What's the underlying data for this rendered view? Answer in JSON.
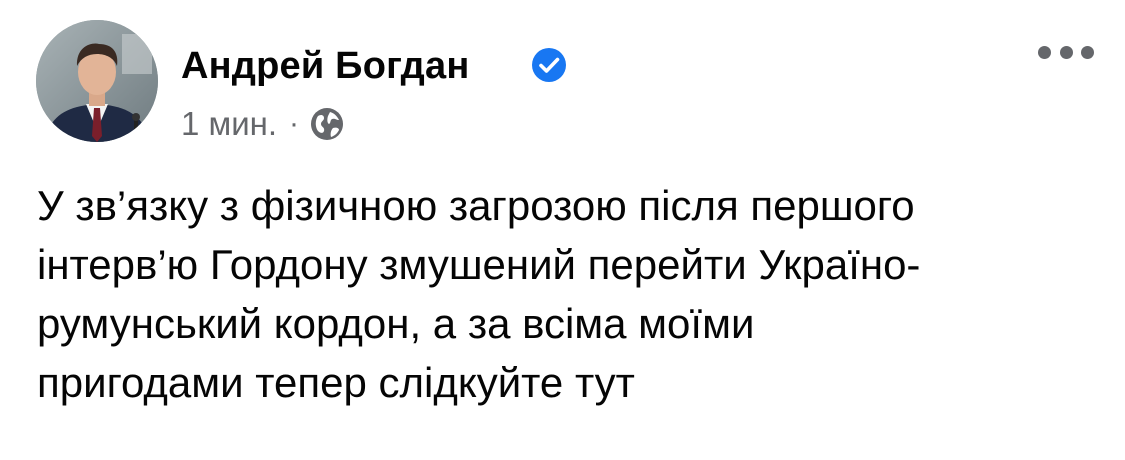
{
  "post": {
    "author": {
      "name": "Андрей Богдан",
      "verified": true,
      "verified_color": "#1877f2"
    },
    "meta": {
      "timestamp": "1 мин.",
      "separator": "·",
      "audience_icon": "globe-icon"
    },
    "menu_icon": "more-horizontal-icon",
    "text_lines": [
      "У зв’язку з фізичною загрозою після першого",
      "інтерв’ю Гордону змушений перейти Україно-",
      "румунський кордон, а за всіма моїми",
      "пригодами тепер слідкуйте тут"
    ]
  }
}
